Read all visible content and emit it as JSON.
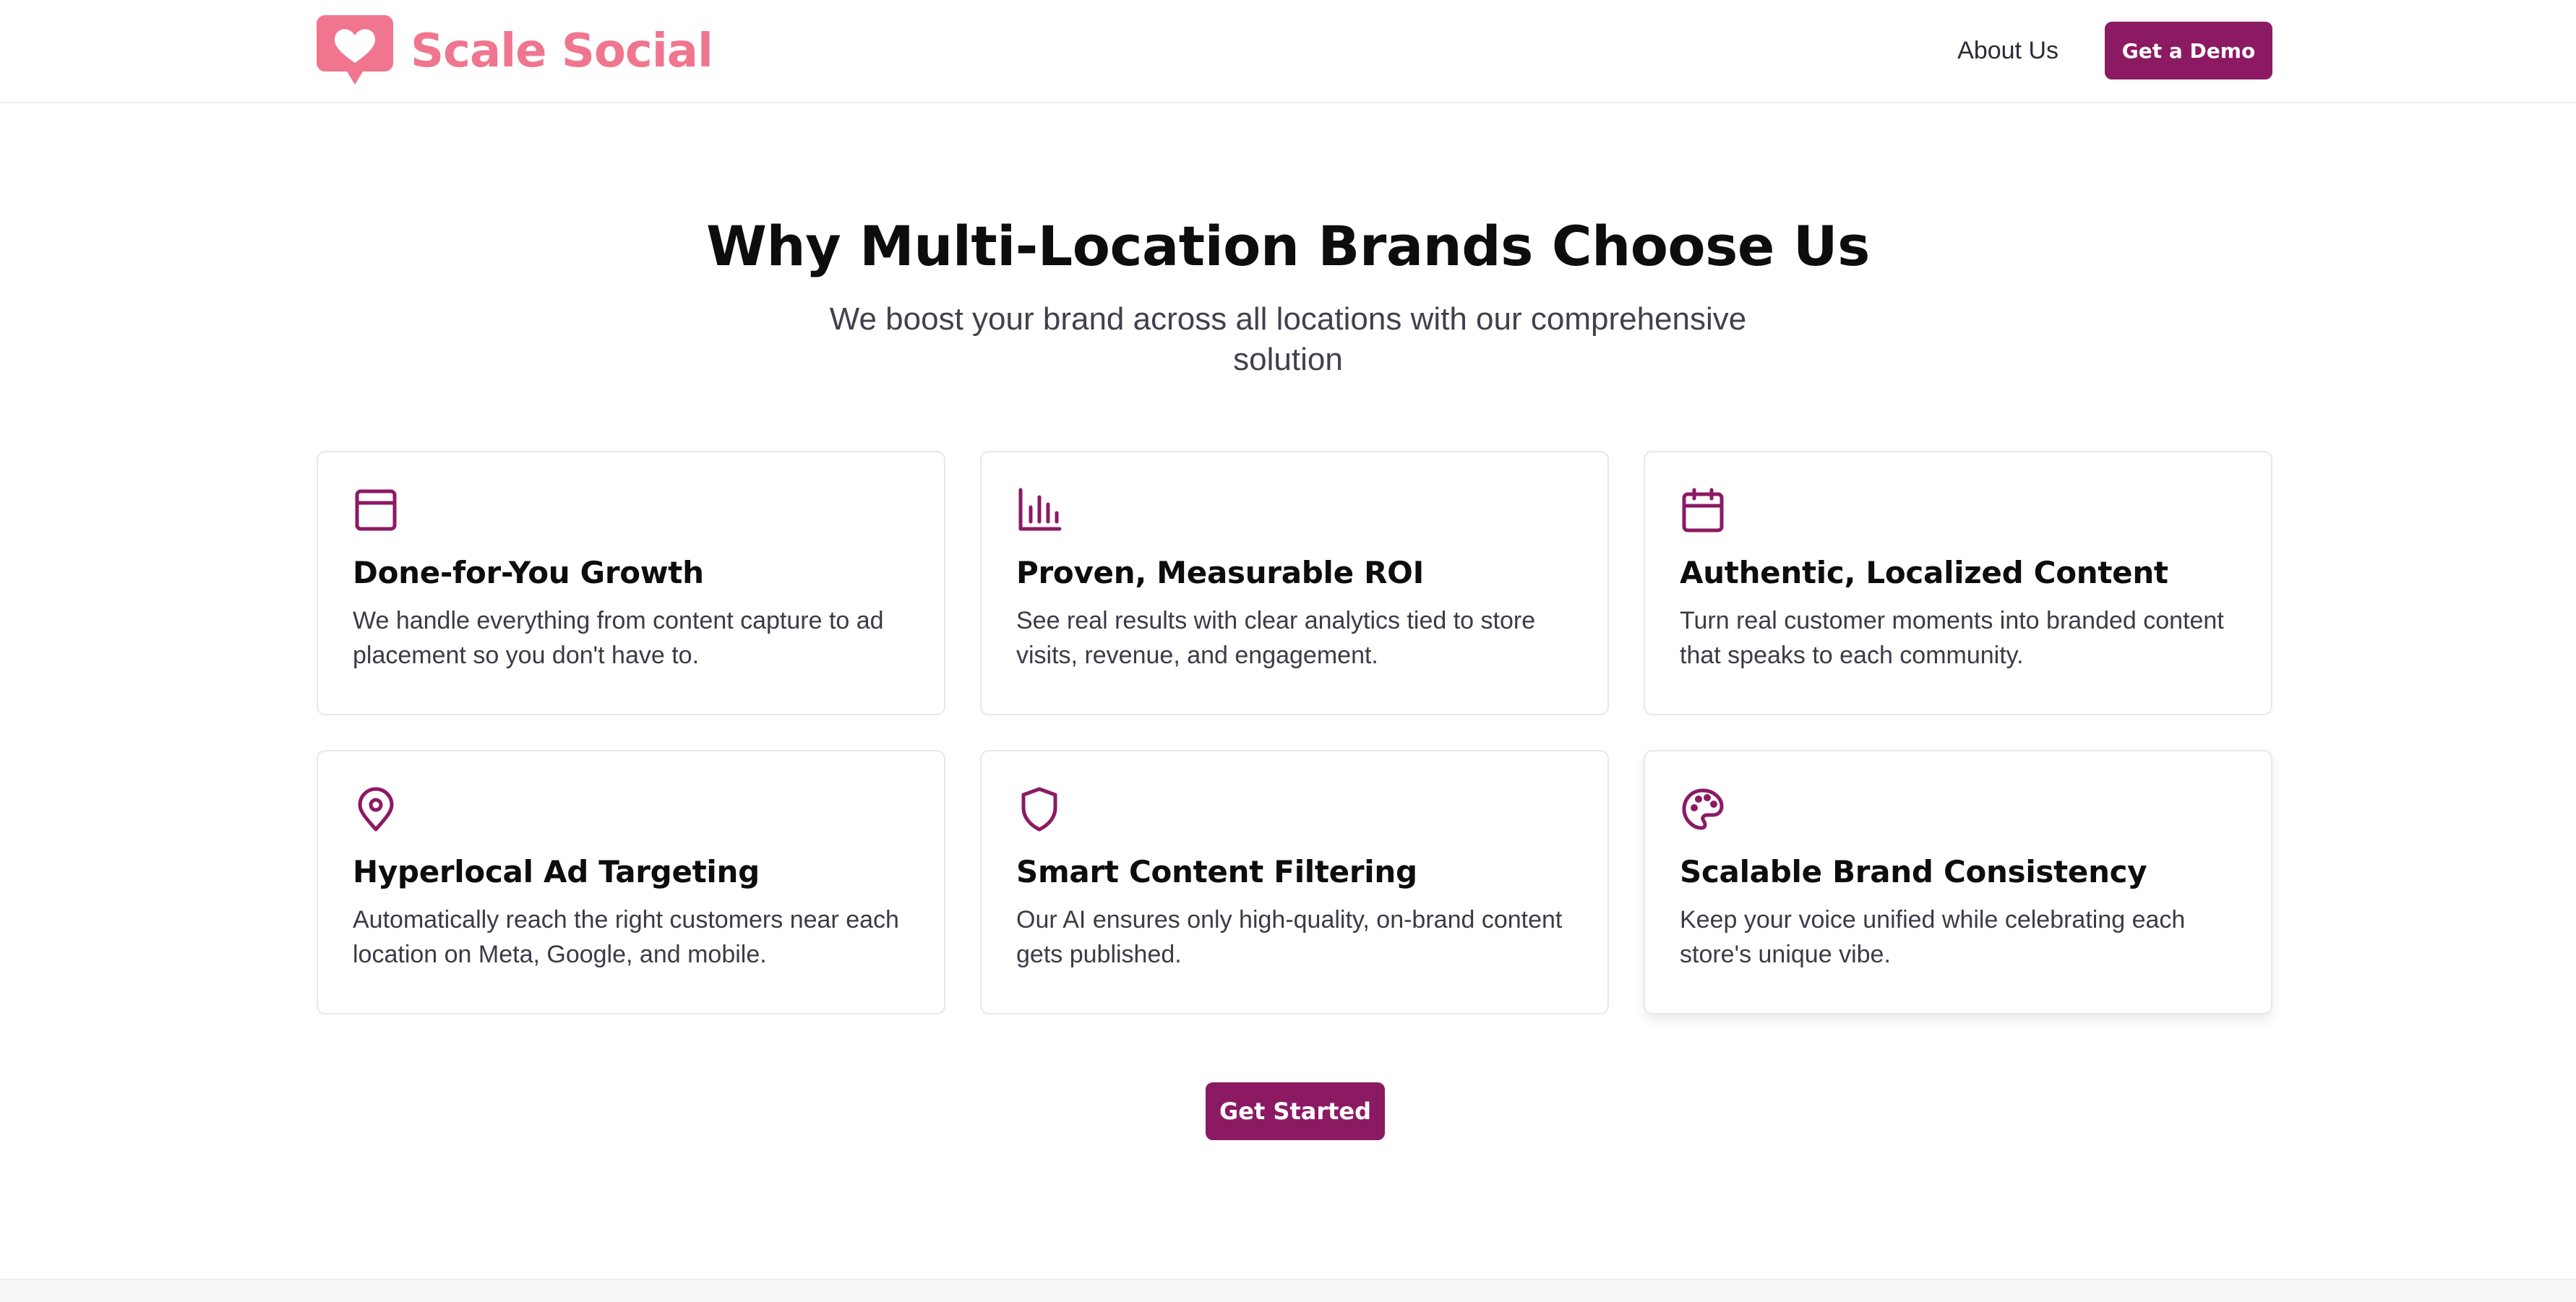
{
  "header": {
    "brand_name": "Scale Social",
    "logo_icon": "heart-chat-bubble-icon",
    "nav": {
      "about_label": "About Us",
      "demo_label": "Get a Demo"
    }
  },
  "hero": {
    "title": "Why Multi-Location Brands Choose Us",
    "subtitle": "We boost your brand across all locations with our comprehensive solution"
  },
  "features": [
    {
      "icon": "window-icon",
      "title": "Done-for-You Growth",
      "description": "We handle everything from content capture to ad placement so you don't have to."
    },
    {
      "icon": "bar-chart-icon",
      "title": "Proven, Measurable ROI",
      "description": "See real results with clear analytics tied to store visits, revenue, and engagement."
    },
    {
      "icon": "calendar-icon",
      "title": "Authentic, Localized Content",
      "description": "Turn real customer moments into branded content that speaks to each community."
    },
    {
      "icon": "map-pin-icon",
      "title": "Hyperlocal Ad Targeting",
      "description": "Automatically reach the right customers near each location on Meta, Google, and mobile."
    },
    {
      "icon": "shield-icon",
      "title": "Smart Content Filtering",
      "description": "Our AI ensures only high-quality, on-brand content gets published."
    },
    {
      "icon": "palette-icon",
      "title": "Scalable Brand Consistency",
      "description": "Keep your voice unified while celebrating each store's unique vibe."
    }
  ],
  "cta": {
    "label": "Get Started"
  },
  "colors": {
    "brand_pink": "#f0758e",
    "primary": "#8b1a63",
    "text_dark": "#0d0d0d",
    "text_muted": "#41414d",
    "card_border": "#e7e7ec"
  }
}
